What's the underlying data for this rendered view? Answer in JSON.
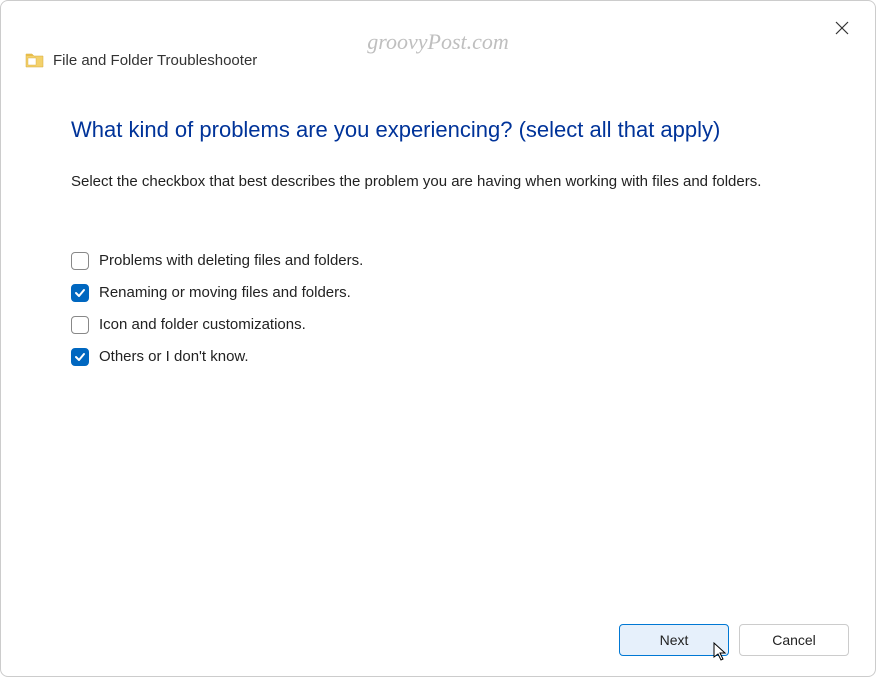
{
  "watermark": "groovyPost.com",
  "header": {
    "title": "File and Folder Troubleshooter"
  },
  "main": {
    "heading": "What kind of problems are you experiencing? (select all that apply)",
    "description": "Select the checkbox that best describes the problem you are having when working with files and folders."
  },
  "checkboxes": [
    {
      "label": "Problems with deleting files and folders.",
      "checked": false
    },
    {
      "label": "Renaming or moving files and folders.",
      "checked": true
    },
    {
      "label": "Icon and folder customizations.",
      "checked": false
    },
    {
      "label": "Others or I don't know.",
      "checked": true
    }
  ],
  "footer": {
    "next": "Next",
    "cancel": "Cancel"
  }
}
